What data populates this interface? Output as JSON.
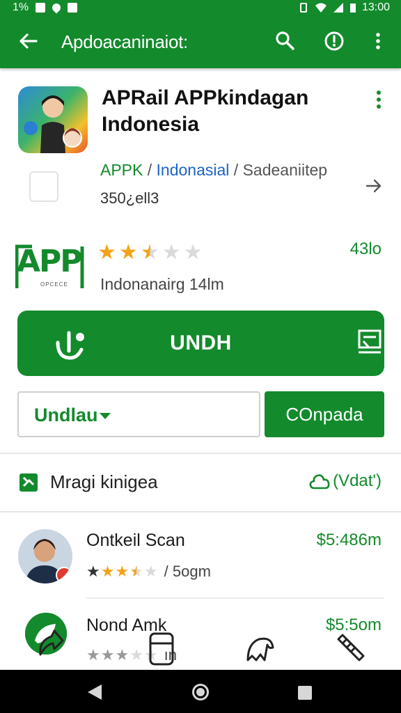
{
  "status_bar": {
    "left_text": "1%",
    "time": "13:00"
  },
  "app_bar": {
    "title": "Apdoacaninaiot:",
    "back_icon": "arrow-left-icon",
    "actions": [
      "search-icon",
      "info-icon",
      "more-vert-icon"
    ],
    "color": "#138a2c"
  },
  "app": {
    "title": "APRail APPkindagan Indonesia",
    "meta": {
      "part1": "APPK",
      "sep1": " / ",
      "part2": "Indonasial",
      "sep2": " / ",
      "part3": "Sadeaniitep"
    },
    "size": "350¿ell3"
  },
  "rating": {
    "brand_text": "APP",
    "brand_sub": "OPCECE",
    "stars": 2.5,
    "count": "43lo",
    "subtitle": "Indonanairg 14lm"
  },
  "install": {
    "label": "UNDH"
  },
  "download_select": {
    "label": "Undlau"
  },
  "compare": {
    "label": "COnpada"
  },
  "section": {
    "title": "Mragi kinigea",
    "link": "(Vdat')"
  },
  "items": [
    {
      "title": "Ontkeil Scan",
      "price": "$5:486m",
      "stars": 3.5,
      "meta": "/ 5ogm"
    },
    {
      "title": "Nond Amk",
      "price": "$5:5om",
      "stars": 3,
      "meta": "ın"
    }
  ],
  "colors": {
    "accent": "#138a2c",
    "star": "#f2a31a",
    "link": "#1a64c8"
  }
}
